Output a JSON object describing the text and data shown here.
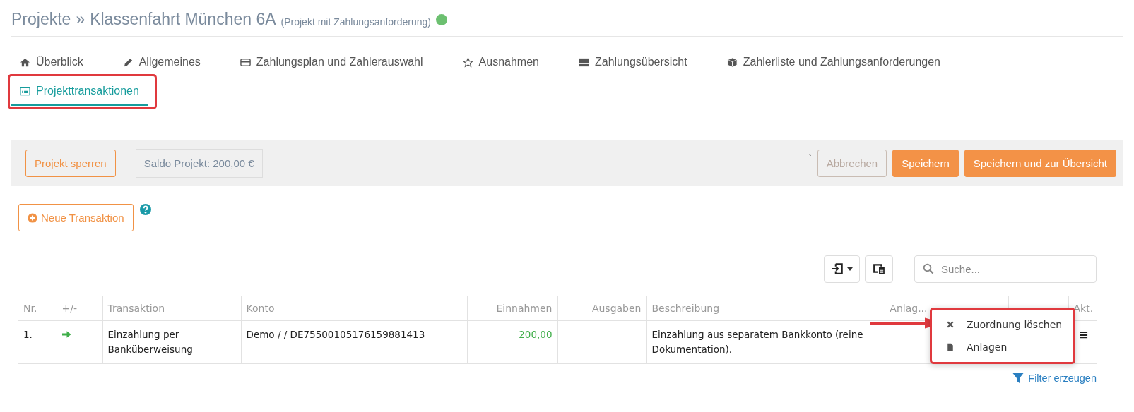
{
  "breadcrumb": {
    "parent": "Projekte",
    "separator": "»",
    "title": "Klassenfahrt München 6A",
    "subtitle": "(Projekt mit Zahlungsanforderung)"
  },
  "tabs": [
    {
      "label": "Überblick",
      "selected": false
    },
    {
      "label": "Allgemeines",
      "selected": false
    },
    {
      "label": "Zahlungsplan und Zahlerauswahl",
      "selected": false
    },
    {
      "label": "Ausnahmen",
      "selected": false
    },
    {
      "label": "Zahlungsübersicht",
      "selected": false
    },
    {
      "label": "Zahlerliste und Zahlungsanforderungen",
      "selected": false
    },
    {
      "label": "Projekttransaktionen",
      "selected": true
    }
  ],
  "action_bar": {
    "lock_button": "Projekt sperren",
    "balance": "Saldo Projekt: 200,00 €",
    "tick": "`",
    "buttons": [
      {
        "label": "Abbrechen",
        "kind": "secondary"
      },
      {
        "label": "Speichern",
        "kind": "primary"
      },
      {
        "label": "Speichern und zur Übersicht",
        "kind": "primary"
      }
    ]
  },
  "new_button": "Neue Transaktion",
  "search": {
    "placeholder": "Suche..."
  },
  "table": {
    "columns": [
      "Nr.",
      "+/-",
      "Transaktion",
      "Konto",
      "Einnahmen",
      "Ausgaben",
      "Beschreibung",
      "Anlag...",
      "Akt."
    ],
    "rows": [
      {
        "nr": "1.",
        "incoming": true,
        "transaktion": "Einzahlung per Banküberweisung",
        "konto": "Demo / / DE75500105176159881413",
        "einnahmen": "200,00",
        "beschreibung": "Einzahlung aus separatem Bankkonto (reine Dokumentation).",
        "menu": "≡"
      }
    ]
  },
  "context_menu": [
    "Zuordnung löschen",
    "Anlagen"
  ],
  "filter_link": "Filter erzeugen"
}
